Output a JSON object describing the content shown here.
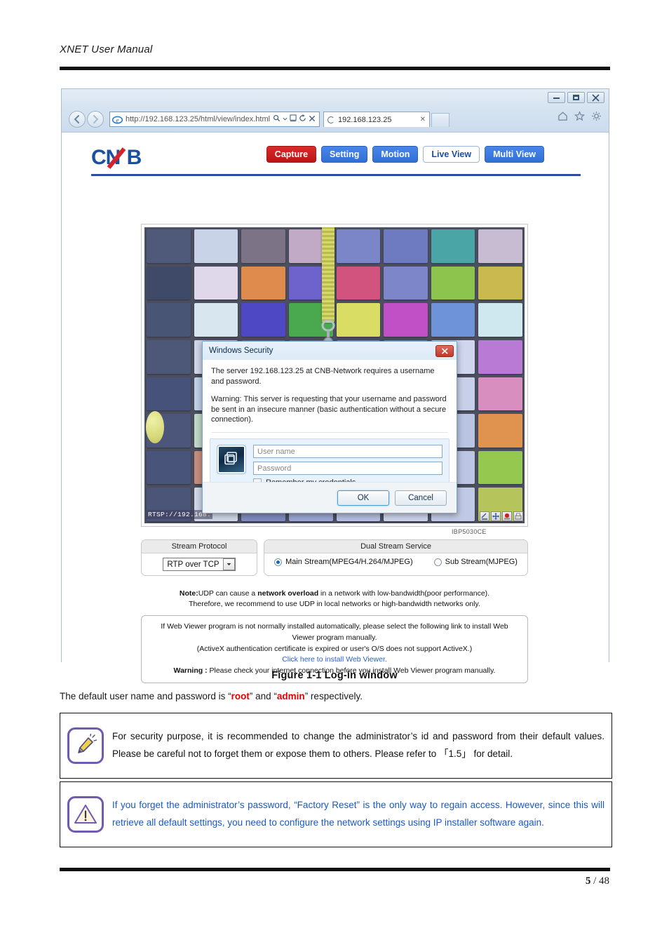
{
  "document": {
    "header_title": "XNET User Manual",
    "figure_caption": "Figure 1-1 Log-in window",
    "body_text_before": "The default user name and password is “",
    "body_highlight_1": "root",
    "body_text_mid": "” and “",
    "body_highlight_2": "admin",
    "body_text_after": "” respectively.",
    "page_current": "5",
    "page_separator": "/",
    "page_total": "48"
  },
  "browser": {
    "window_controls": {
      "minimize": "minimize-button",
      "restore": "restore-button",
      "close": "close-button"
    },
    "back_label": "←",
    "forward_label": "→",
    "address_url_prefix": "http://",
    "address_url_host": "192.168.123.25",
    "address_url_path": "/html/view/index.html",
    "address_full": "http://192.168.123.25/html/view/index.html",
    "address_icons": [
      "search-icon",
      "compatibility-icon",
      "refresh-icon",
      "stop-icon"
    ],
    "tab_title": "192.168.123.25",
    "tab_close_label": "✕",
    "right_icons": [
      "home-icon",
      "favorites-icon",
      "tools-gear-icon"
    ]
  },
  "cnb": {
    "logo_c": "C",
    "logo_n": "N",
    "logo_b": "B",
    "nav_buttons": [
      {
        "label": "Capture",
        "style": "capture"
      },
      {
        "label": "Setting",
        "style": "blue"
      },
      {
        "label": "Motion",
        "style": "blue"
      },
      {
        "label": "Live View",
        "style": "active"
      },
      {
        "label": "Multi View",
        "style": "blue"
      }
    ]
  },
  "video": {
    "rtsp_overlay": "RTSP://192.168.",
    "model_label": "IBP5030CE",
    "tool_icons": [
      "ratio-icon",
      "move-icon",
      "record-icon",
      "save-icon"
    ],
    "swatch_rows": [
      [
        "#4f5a7a",
        "#c9d3e8",
        "#7c7486",
        "#c0aac6",
        "#7a86c8",
        "#6f7bc0",
        "#4aa6a6",
        "#c8bcd2"
      ],
      [
        "#3f4a68",
        "#ded8ea",
        "#df8b4d",
        "#6e63cd",
        "#d2537d",
        "#7d86c9",
        "#8cc44e",
        "#c9b94f"
      ],
      [
        "#495574",
        "#d8e7ef",
        "#4f48c4",
        "#4aa84e",
        "#d9dd64",
        "#c150c6",
        "#6f93d8",
        "#cfe7ef"
      ],
      [
        "#4d5878",
        "#cfd5e8",
        "#6d74b9",
        "#5d7ad0",
        "#b36fd0",
        "#8f7ac4",
        "#cfd6ee",
        "#b87ad4"
      ],
      [
        "#46527a",
        "#bfd0e6",
        "#7f8ec4",
        "#6b7ab8",
        "#9fb0dc",
        "#c3cbe6",
        "#c8cfe8",
        "#d88fc0"
      ],
      [
        "#4b567a",
        "#bfd8c8",
        "#7a86ba",
        "#8e9ad2",
        "#aab6de",
        "#c5cde8",
        "#b9c4e2",
        "#e0924f"
      ],
      [
        "#49547a",
        "#c68e7e",
        "#7682b8",
        "#97a3d2",
        "#b2bde0",
        "#cad2ea",
        "#bcc6e4",
        "#94c84e"
      ],
      [
        "#4a5578",
        "#cfd7e8",
        "#808cc0",
        "#9aa6d4",
        "#b6c0e2",
        "#ccd4ec",
        "#c0cae6",
        "#b6c45c"
      ]
    ]
  },
  "windows_security": {
    "title": "Windows Security",
    "close_label": "✕",
    "paragraph_1": "The server 192.168.123.25 at CNB-Network requires a username and password.",
    "paragraph_2": "Warning: This server is requesting that your username and password be sent in an insecure manner (basic authentication without a secure connection).",
    "username_placeholder": "User name",
    "username_value": "",
    "password_placeholder": "Password",
    "password_value": "",
    "remember_label": "Remember my credentials",
    "remember_checked": false,
    "ok_label": "OK",
    "cancel_label": "Cancel",
    "credential_icon": "credential-cards-icon"
  },
  "stream": {
    "protocol_panel_title": "Stream Protocol",
    "protocol_selected": "RTP over TCP",
    "dual_panel_title": "Dual Stream Service",
    "radio_main_label": "Main Stream(MPEG4/H.264/MJPEG)",
    "radio_sub_label": "Sub Stream(MJPEG)",
    "radio_selected": "main",
    "note_bold": "Note:",
    "note_line1_a": "UDP can cause a ",
    "note_line1_b": "network overload",
    "note_line1_c": " in a network with low-bandwidth(poor performance).",
    "note_line2": "Therefore, we recommend to use UDP in local networks or high-bandwidth networks only."
  },
  "viewer_notice": {
    "line1": "If Web Viewer program is not normally installed automatically, please select the following link to install Web Viewer program manually.",
    "line2": "(ActiveX authentication certificate is expired or user's O/S does not support ActiveX.)",
    "link": "Click here to install Web Viewer.",
    "line3_bold": "Warning : ",
    "line3_rest": "Please check your internet connection before you install Web Viewer program manually."
  },
  "notes": [
    {
      "icon": "highlighter-pen-icon",
      "text": "For security purpose, it is recommended to change the administrator’s id and password from their default values. Please be careful not to forget them or expose them to others.   Please refer to 「1.5」 for detail.",
      "color": "black"
    },
    {
      "icon": "warning-triangle-icon",
      "text": "If you forget the administrator’s password, “Factory Reset” is the only way to regain access. However, since this will retrieve all default settings, you need to configure the network settings using IP installer software again.",
      "color": "blue"
    }
  ]
}
